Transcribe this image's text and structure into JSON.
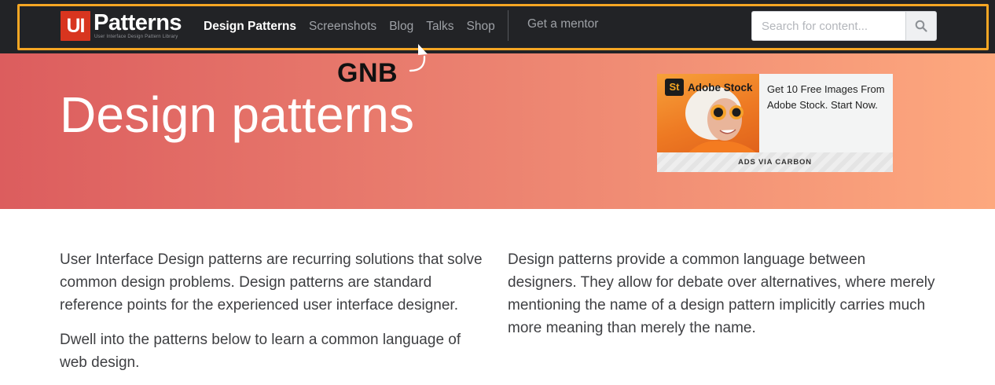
{
  "gnb": {
    "logo": {
      "mark": "UI",
      "word": "Patterns",
      "tagline": "User Interface Design Pattern Library"
    },
    "nav": [
      {
        "label": "Design Patterns",
        "active": true
      },
      {
        "label": "Screenshots",
        "active": false
      },
      {
        "label": "Blog",
        "active": false
      },
      {
        "label": "Talks",
        "active": false
      },
      {
        "label": "Shop",
        "active": false
      }
    ],
    "mentor_label": "Get a mentor",
    "search": {
      "placeholder": "Search for content...",
      "icon": "search-icon"
    },
    "highlight_color": "#f5a623"
  },
  "annotation": {
    "label": "GNB"
  },
  "hero": {
    "title": "Design patterns",
    "gradient": [
      "#dc5d5e",
      "#fda87e"
    ],
    "ad": {
      "brand_mark": "St",
      "brand_name": "Adobe Stock",
      "text": "Get 10 Free Images From Adobe Stock. Start Now.",
      "via": "ADS VIA CARBON"
    }
  },
  "content": {
    "left": [
      "User Interface Design patterns are recurring solutions that solve common design problems. Design patterns are standard reference points for the experienced user interface designer.",
      "Dwell into the patterns below to learn a common language of web design."
    ],
    "right": [
      "Design patterns provide a common language between designers. They allow for debate over alternatives, where merely mentioning the name of a design pattern implicitly carries much more meaning than merely the name."
    ]
  }
}
